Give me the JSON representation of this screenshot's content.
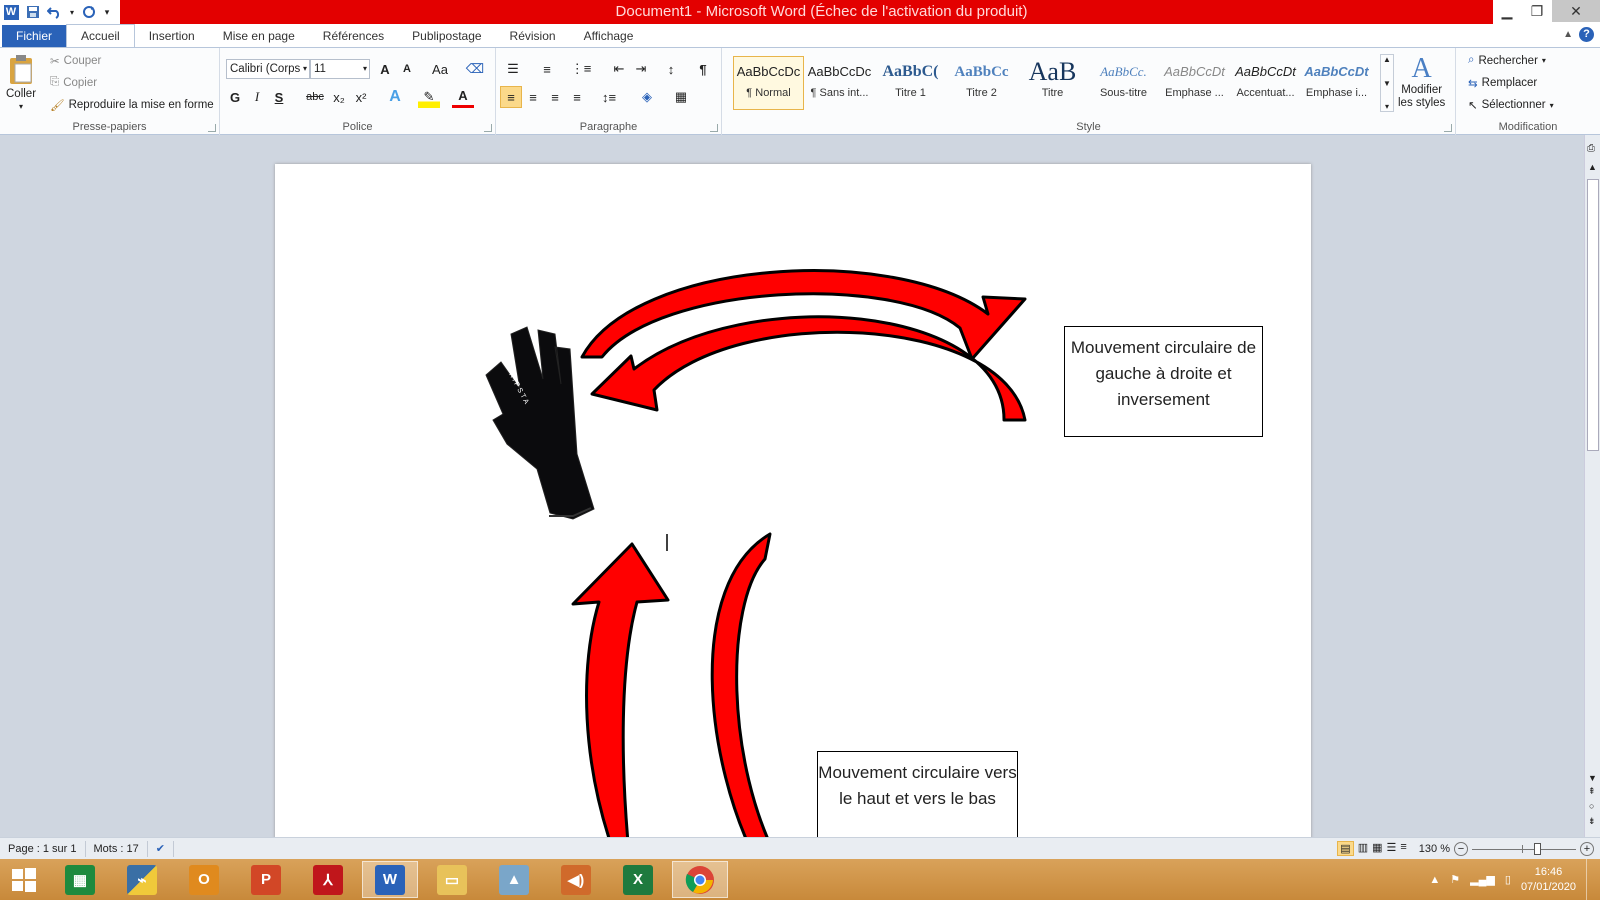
{
  "titlebar": {
    "title": "Document1  -  Microsoft Word (Échec de l'activation du produit)",
    "word_icon": "W"
  },
  "tabs": [
    "Fichier",
    "Accueil",
    "Insertion",
    "Mise en page",
    "Références",
    "Publipostage",
    "Révision",
    "Affichage"
  ],
  "clipboard": {
    "paste": "Coller",
    "cut": "Couper",
    "copy": "Copier",
    "format_painter": "Reproduire la mise en forme",
    "group": "Presse-papiers"
  },
  "font": {
    "name": "Calibri (Corps",
    "size": "11",
    "bold": "G",
    "italic": "I",
    "underline": "S",
    "strike": "abc",
    "subscript": "x₂",
    "superscript": "x²",
    "grow": "A",
    "shrink": "A",
    "change_case": "Aa",
    "group": "Police"
  },
  "paragraph": {
    "group": "Paragraphe",
    "pilcrow": "¶"
  },
  "styles": {
    "group": "Style",
    "items": [
      {
        "preview": "AaBbCcDc",
        "name": "¶ Normal"
      },
      {
        "preview": "AaBbCcDc",
        "name": "¶ Sans int..."
      },
      {
        "preview": "AaBbC(",
        "name": "Titre 1"
      },
      {
        "preview": "AaBbCc",
        "name": "Titre 2"
      },
      {
        "preview": "AaB",
        "name": "Titre"
      },
      {
        "preview": "AaBbCc.",
        "name": "Sous-titre"
      },
      {
        "preview": "AaBbCcDt",
        "name": "Emphase ..."
      },
      {
        "preview": "AaBbCcDt",
        "name": "Accentuat..."
      },
      {
        "preview": "AaBbCcDt",
        "name": "Emphase i..."
      }
    ],
    "modify_line1": "Modifier",
    "modify_line2": "les styles"
  },
  "editing": {
    "find": "Rechercher",
    "replace": "Remplacer",
    "select": "Sélectionner",
    "group": "Modification"
  },
  "document": {
    "box1": "Mouvement circulaire de gauche à droite et inversement",
    "box2": "Mouvement circulaire vers le haut et vers le bas",
    "glove_brand": "KIPSTA"
  },
  "status": {
    "page": "Page : 1 sur 1",
    "words": "Mots : 17",
    "zoom": "130 %"
  },
  "taskbar": {
    "time": "16:46",
    "date": "07/01/2020"
  },
  "colors": {
    "title_red": "#e30000",
    "arrow_red": "#ff0000",
    "file_tab": "#2a62b8",
    "taskbar": "#c8893a"
  }
}
